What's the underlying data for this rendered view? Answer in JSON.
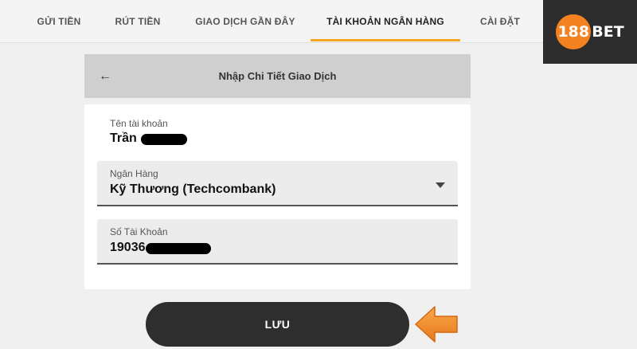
{
  "nav": {
    "tabs": [
      {
        "label": "GỬI TIỀN"
      },
      {
        "label": "RÚT TIỀN"
      },
      {
        "label": "GIAO DỊCH GẦN ĐÂY"
      },
      {
        "label": "TÀI KHOẢN NGÂN HÀNG"
      },
      {
        "label": "CÀI ĐẶT"
      }
    ],
    "active_tab": "TÀI KHOẢN NGÂN HÀNG"
  },
  "logo": {
    "number": "188",
    "text": "BET"
  },
  "form": {
    "back_icon": "←",
    "title": "Nhập Chi Tiết Giao Dịch",
    "account_name": {
      "label": "Tên tài khoản",
      "value": "Trần"
    },
    "bank": {
      "label": "Ngân Hàng",
      "value": "Kỹ Thương (Techcombank)"
    },
    "account_number": {
      "label": "Số Tài Khoản",
      "value": "19036"
    }
  },
  "save_button": {
    "label": "LƯU"
  },
  "colors": {
    "accent": "#f5a623",
    "logo_orange": "#f58220",
    "dark": "#2e2e2e"
  },
  "icons": [
    "back-arrow-icon",
    "chevron-down-icon",
    "pointer-arrow-icon"
  ]
}
